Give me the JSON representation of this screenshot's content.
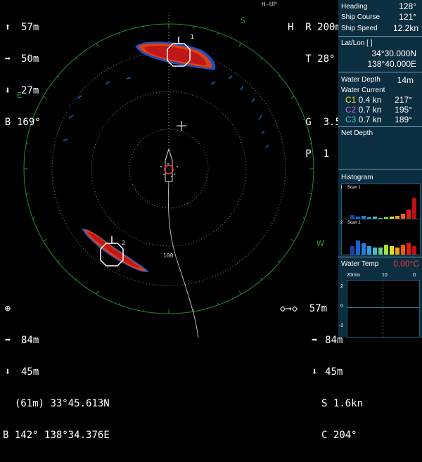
{
  "top_left": {
    "rows": [
      {
        "icon": "up-arrow-icon",
        "value": "57m"
      },
      {
        "icon": "right-arrow-icon",
        "value": "50m"
      },
      {
        "icon": "down-arrow-icon",
        "value": "27m"
      },
      {
        "icon": "B",
        "value": "169°"
      }
    ]
  },
  "top_right": {
    "mode": "H-UP",
    "h": "H",
    "r_label": "R",
    "range": "200m",
    "t_label": "T",
    "tilt": "28°",
    "g_label": "G",
    "gain": "3.5",
    "p_label": "P",
    "p_val": "1"
  },
  "compass": {
    "s": "S",
    "e": "E",
    "w": "W"
  },
  "range_ring_label": "100",
  "bottom_left": {
    "rows": [
      {
        "icon": "right-arrow-icon",
        "value": "84m"
      },
      {
        "icon": "down-arrow-icon",
        "value": "45m"
      }
    ],
    "depth_paren": "(61m)",
    "lat": "33°45.613N",
    "b_label": "B",
    "bearing": "142°",
    "lon": "138°34.376E"
  },
  "bottom_right": {
    "rows": [
      {
        "icon": "up-arrow-icon",
        "value": "57m"
      },
      {
        "icon": "right-arrow-icon",
        "value": "84m"
      },
      {
        "icon": "down-arrow-icon",
        "value": "45m"
      }
    ],
    "s_label": "S",
    "speed": "1.6kn",
    "c_label": "C",
    "course": "204°"
  },
  "panel": {
    "heading_label": "Heading",
    "heading": "128°",
    "course_label": "Ship Course",
    "course": "121°",
    "speed_label": "Ship Speed",
    "speed": "12.2kn",
    "latlon_label": "Lat/Lon [ ]",
    "lat": "34°30.000N",
    "lon": "138°40.000E",
    "water_depth_label": "Water Depth",
    "water_depth": "14m",
    "current_label": "Water Current",
    "currents": [
      {
        "name": "C1",
        "speed": "0.4 kn",
        "dir": "217°",
        "color": "#f0e020"
      },
      {
        "name": "C2",
        "speed": "0.7 kn",
        "dir": "195°",
        "color": "#d060e0"
      },
      {
        "name": "C3",
        "speed": "0.7 kn",
        "dir": "189°",
        "color": "#30d0d0"
      }
    ],
    "net_depth_label": "Net Depth",
    "histogram_label": "Histogram",
    "hist1_num": "1",
    "hist1_name": "Scan 1",
    "hist2_num": "2",
    "hist2_name": "Scan 1",
    "water_temp_label": "Water Temp",
    "water_temp": "0.00°C",
    "graph_top": {
      "left": "20min",
      "mid": "10",
      "right": "0"
    },
    "graph_y": [
      "2",
      "0",
      "-2"
    ]
  }
}
